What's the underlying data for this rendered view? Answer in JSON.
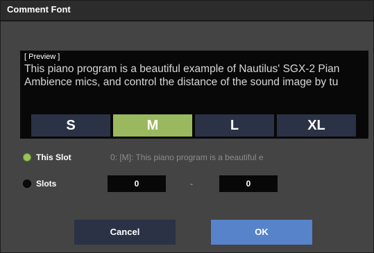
{
  "dialog": {
    "title": "Comment Font"
  },
  "preview": {
    "label": "[ Preview ]",
    "lines": [
      "This piano program is a beautiful example of Nautilus' SGX-2 Pian",
      "Ambience mics, and control the distance of the sound image by tu"
    ]
  },
  "sizes": {
    "s": "S",
    "m": "M",
    "l": "L",
    "xl": "XL",
    "selected": "M"
  },
  "options": {
    "this_slot": {
      "label": "This Slot",
      "selected": true,
      "value_text": "0: [M]: This piano program is a beautiful e"
    },
    "slots": {
      "label": "Slots",
      "selected": false,
      "from": "0",
      "separator": "-",
      "to": "0"
    }
  },
  "buttons": {
    "cancel": "Cancel",
    "ok": "OK"
  },
  "colors": {
    "selected_green": "#9ab95e",
    "ok_blue": "#5683c9",
    "button_navy": "#2b3245",
    "panel_gray": "#444444"
  }
}
